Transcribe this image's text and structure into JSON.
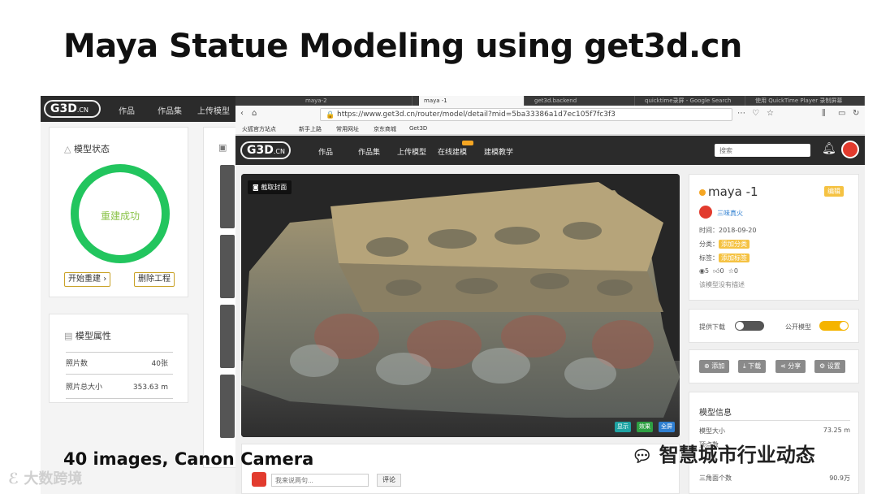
{
  "slide": {
    "title": "Maya Statue Modeling using get3d.cn",
    "caption": "40 images, Canon Camera"
  },
  "bg_window": {
    "logo": "G3D",
    "logo_suffix": ".CN",
    "nav": [
      "作品",
      "作品集",
      "上传模型"
    ],
    "status_card": {
      "title": "模型状态",
      "ring_text": "重建成功",
      "start_button": "开始重建",
      "delete_button": "删除工程"
    },
    "props_card": {
      "title": "模型属性",
      "rows": [
        {
          "label": "照片数",
          "value": "40张"
        },
        {
          "label": "照片总大小",
          "value": "353.63 m"
        }
      ]
    }
  },
  "browser": {
    "tabs": [
      "maya-2",
      "maya -1",
      "get3d.backend",
      "quicktime录屏 - Google Search",
      "使用 QuickTime Player 录制屏幕"
    ],
    "url": "https://www.get3d.cn/router/model/detail?mid=5ba33386a1d7ec105f7fc3f3",
    "bookmarks": [
      "火狐官方站点",
      "新手上路",
      "常用网址",
      "京东商城",
      "Get3D"
    ]
  },
  "site": {
    "logo": "G3D",
    "logo_suffix": ".CN",
    "nav": [
      "作品",
      "作品集",
      "上传模型",
      "在线建模",
      "建模教学"
    ],
    "search_placeholder": "搜索"
  },
  "viewer": {
    "cover_button": "截取封面",
    "buttons": [
      "显示",
      "效果",
      "全屏"
    ]
  },
  "comment": {
    "placeholder": "我来说两句...",
    "submit": "评论"
  },
  "model_info": {
    "name": "maya -1",
    "edit_button": "编辑",
    "author": "三味真火",
    "time": "时间：2018-09-20",
    "category_label": "分类：",
    "category_chip": "添加分类",
    "tag_label": "标签：",
    "tag_chip": "添加标签",
    "views": "5",
    "likes": "0",
    "stars": "0",
    "description": "该模型没有描述"
  },
  "toggles": {
    "download_label": "提供下载",
    "download_on": false,
    "public_label": "公开模型",
    "public_on": true
  },
  "actions": [
    "添加",
    "下载",
    "分享",
    "设置"
  ],
  "details": {
    "title": "模型信息",
    "rows": [
      {
        "label": "模型大小",
        "value": "73.25 m"
      },
      {
        "label": "顶点数",
        "value": ""
      },
      {
        "label": "三角面个数",
        "value": "90.9万"
      }
    ]
  },
  "watermarks": {
    "right": "智慧城市行业动态",
    "left": "大数跨境"
  },
  "colors": {
    "ring": "#22c55e",
    "accent": "#f5c242",
    "nav": "#2b2b2b"
  }
}
